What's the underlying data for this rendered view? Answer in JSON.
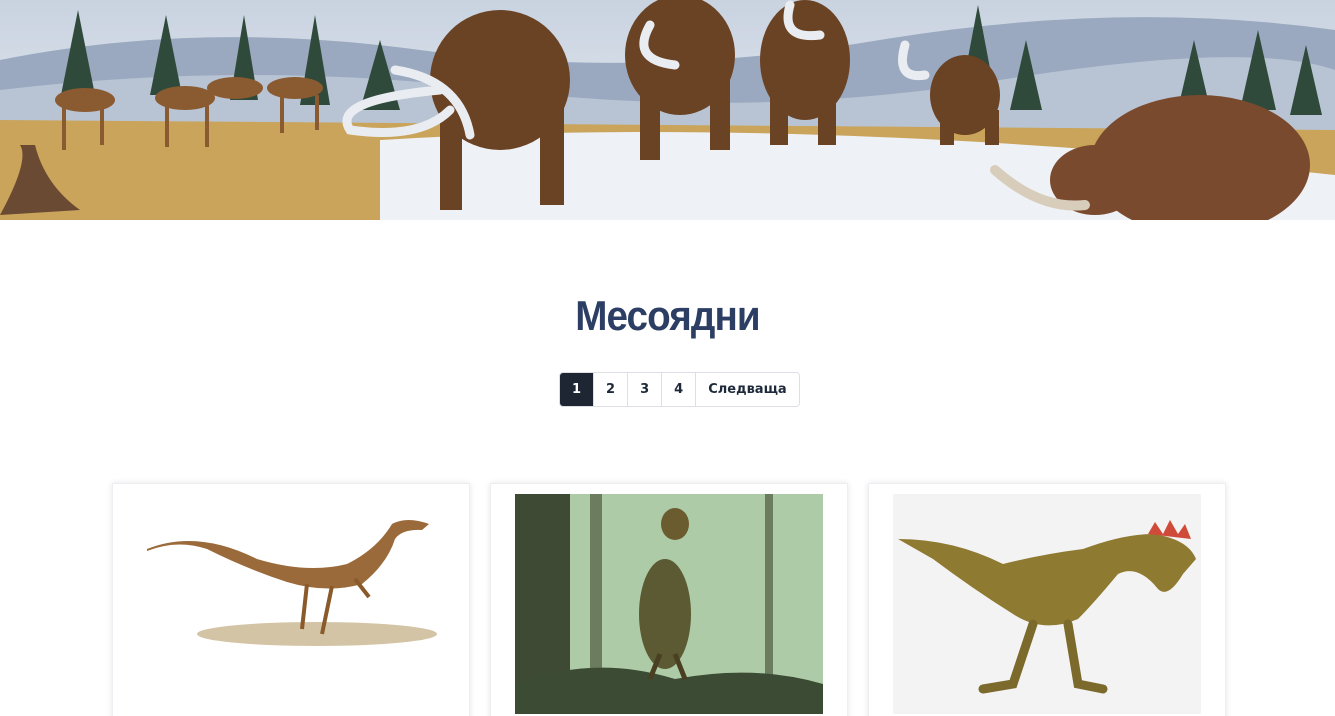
{
  "hero": {
    "image": "ice-age-mammals-banner"
  },
  "page": {
    "title": "Месоядни"
  },
  "pagination": {
    "pages": [
      "1",
      "2",
      "3",
      "4"
    ],
    "active": "1",
    "next_label": "Следваща"
  },
  "cards": [
    {
      "image": "coelophysis-illustration"
    },
    {
      "image": "dilophosaurus-forest-illustration"
    },
    {
      "image": "cryolophosaurus-illustration"
    }
  ],
  "colors": {
    "title": "#2c3e63",
    "pagination_active": "#1e2633"
  }
}
